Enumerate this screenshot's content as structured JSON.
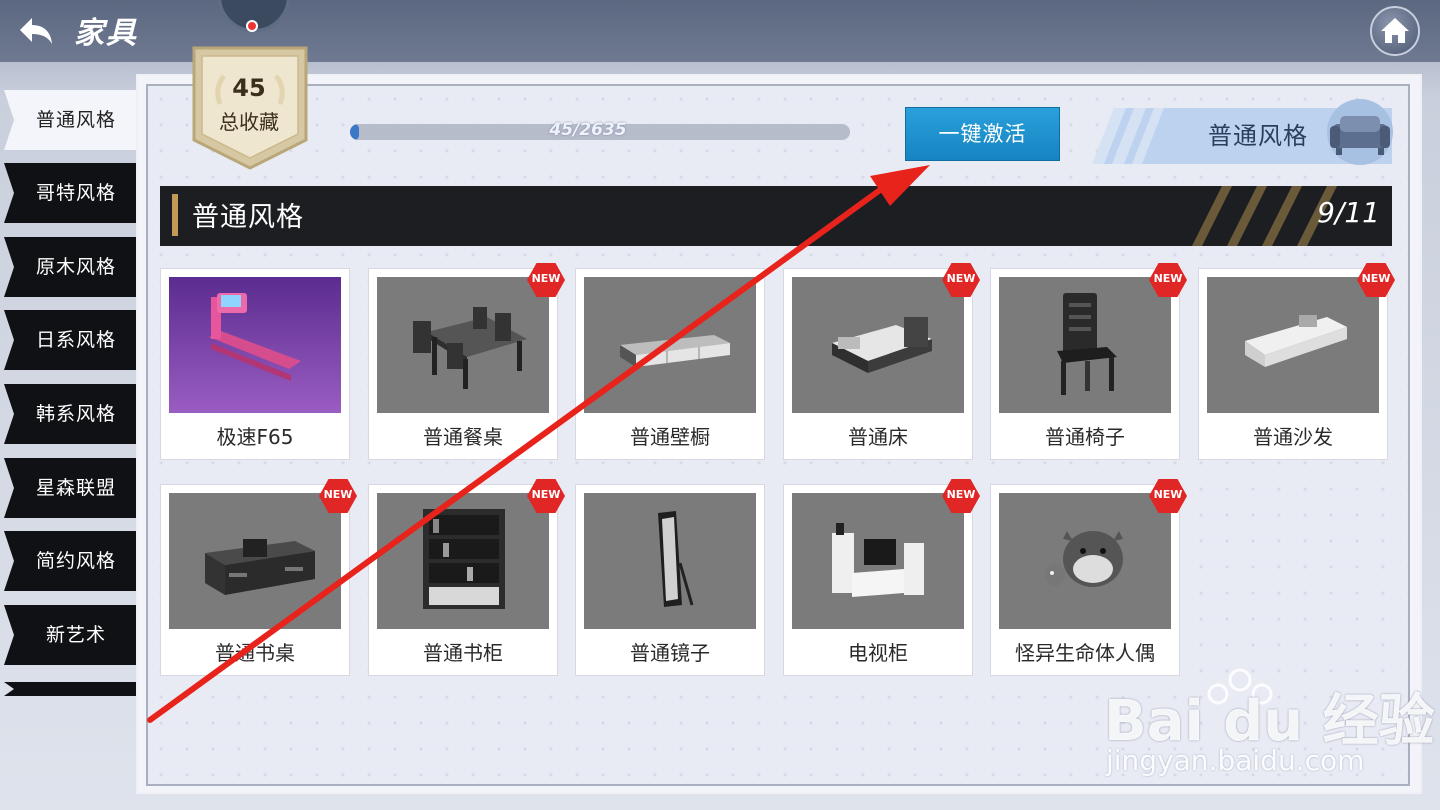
{
  "header": {
    "title": "家具"
  },
  "badge": {
    "count": "45",
    "label": "总收藏"
  },
  "progress": {
    "text": "45/2635",
    "fraction": 0.017
  },
  "activate_button": {
    "label": "一键激活"
  },
  "style_banner": {
    "label": "普通风格"
  },
  "sidebar": {
    "tabs": [
      {
        "label": "普通风格",
        "active": true
      },
      {
        "label": "哥特风格",
        "active": false
      },
      {
        "label": "原木风格",
        "active": false
      },
      {
        "label": "日系风格",
        "active": false
      },
      {
        "label": "韩系风格",
        "active": false
      },
      {
        "label": "星森联盟",
        "active": false
      },
      {
        "label": "简约风格",
        "active": false
      },
      {
        "label": "新艺术",
        "active": false
      }
    ]
  },
  "section": {
    "title": "普通风格",
    "count": "9/11"
  },
  "items": [
    {
      "name": "极速F65",
      "new": false,
      "icon": "treadmill-icon"
    },
    {
      "name": "普通餐桌",
      "new": true,
      "icon": "dining-table-icon"
    },
    {
      "name": "普通壁橱",
      "new": false,
      "icon": "cabinet-icon"
    },
    {
      "name": "普通床",
      "new": true,
      "icon": "bed-icon"
    },
    {
      "name": "普通椅子",
      "new": true,
      "icon": "chair-icon"
    },
    {
      "name": "普通沙发",
      "new": true,
      "icon": "sofa-icon"
    },
    {
      "name": "普通书桌",
      "new": true,
      "icon": "desk-icon"
    },
    {
      "name": "普通书柜",
      "new": true,
      "icon": "bookcase-icon"
    },
    {
      "name": "普通镜子",
      "new": false,
      "icon": "mirror-icon"
    },
    {
      "name": "电视柜",
      "new": true,
      "icon": "tv-stand-icon"
    },
    {
      "name": "怪异生命体人偶",
      "new": true,
      "icon": "creature-doll-icon"
    }
  ],
  "new_tag": "NEW",
  "watermark": {
    "brand": "Bai du 经验",
    "url": "jingyan.baidu.com"
  },
  "colors": {
    "accent": "#1684c0",
    "new_tag": "#e12626",
    "panel_header": "#1d1e22",
    "arrow": "#e8231b"
  }
}
